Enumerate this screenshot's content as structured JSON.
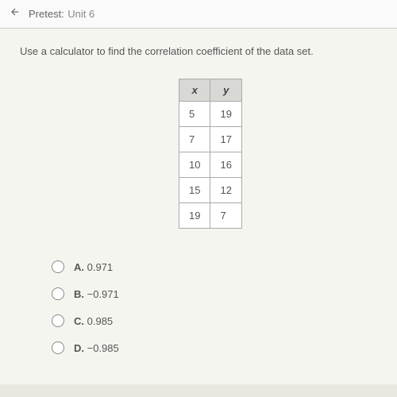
{
  "header": {
    "title": "Pretest:",
    "subtitle": "Unit 6"
  },
  "question": "Use a calculator to find the correlation coefficient of the data set.",
  "table": {
    "headers": {
      "x": "x",
      "y": "y"
    },
    "rows": [
      {
        "x": "5",
        "y": "19"
      },
      {
        "x": "7",
        "y": "17"
      },
      {
        "x": "10",
        "y": "16"
      },
      {
        "x": "15",
        "y": "12"
      },
      {
        "x": "19",
        "y": "7"
      }
    ]
  },
  "options": [
    {
      "letter": "A.",
      "value": "0.971"
    },
    {
      "letter": "B.",
      "value": "−0.971"
    },
    {
      "letter": "C.",
      "value": "0.985"
    },
    {
      "letter": "D.",
      "value": "−0.985"
    }
  ]
}
